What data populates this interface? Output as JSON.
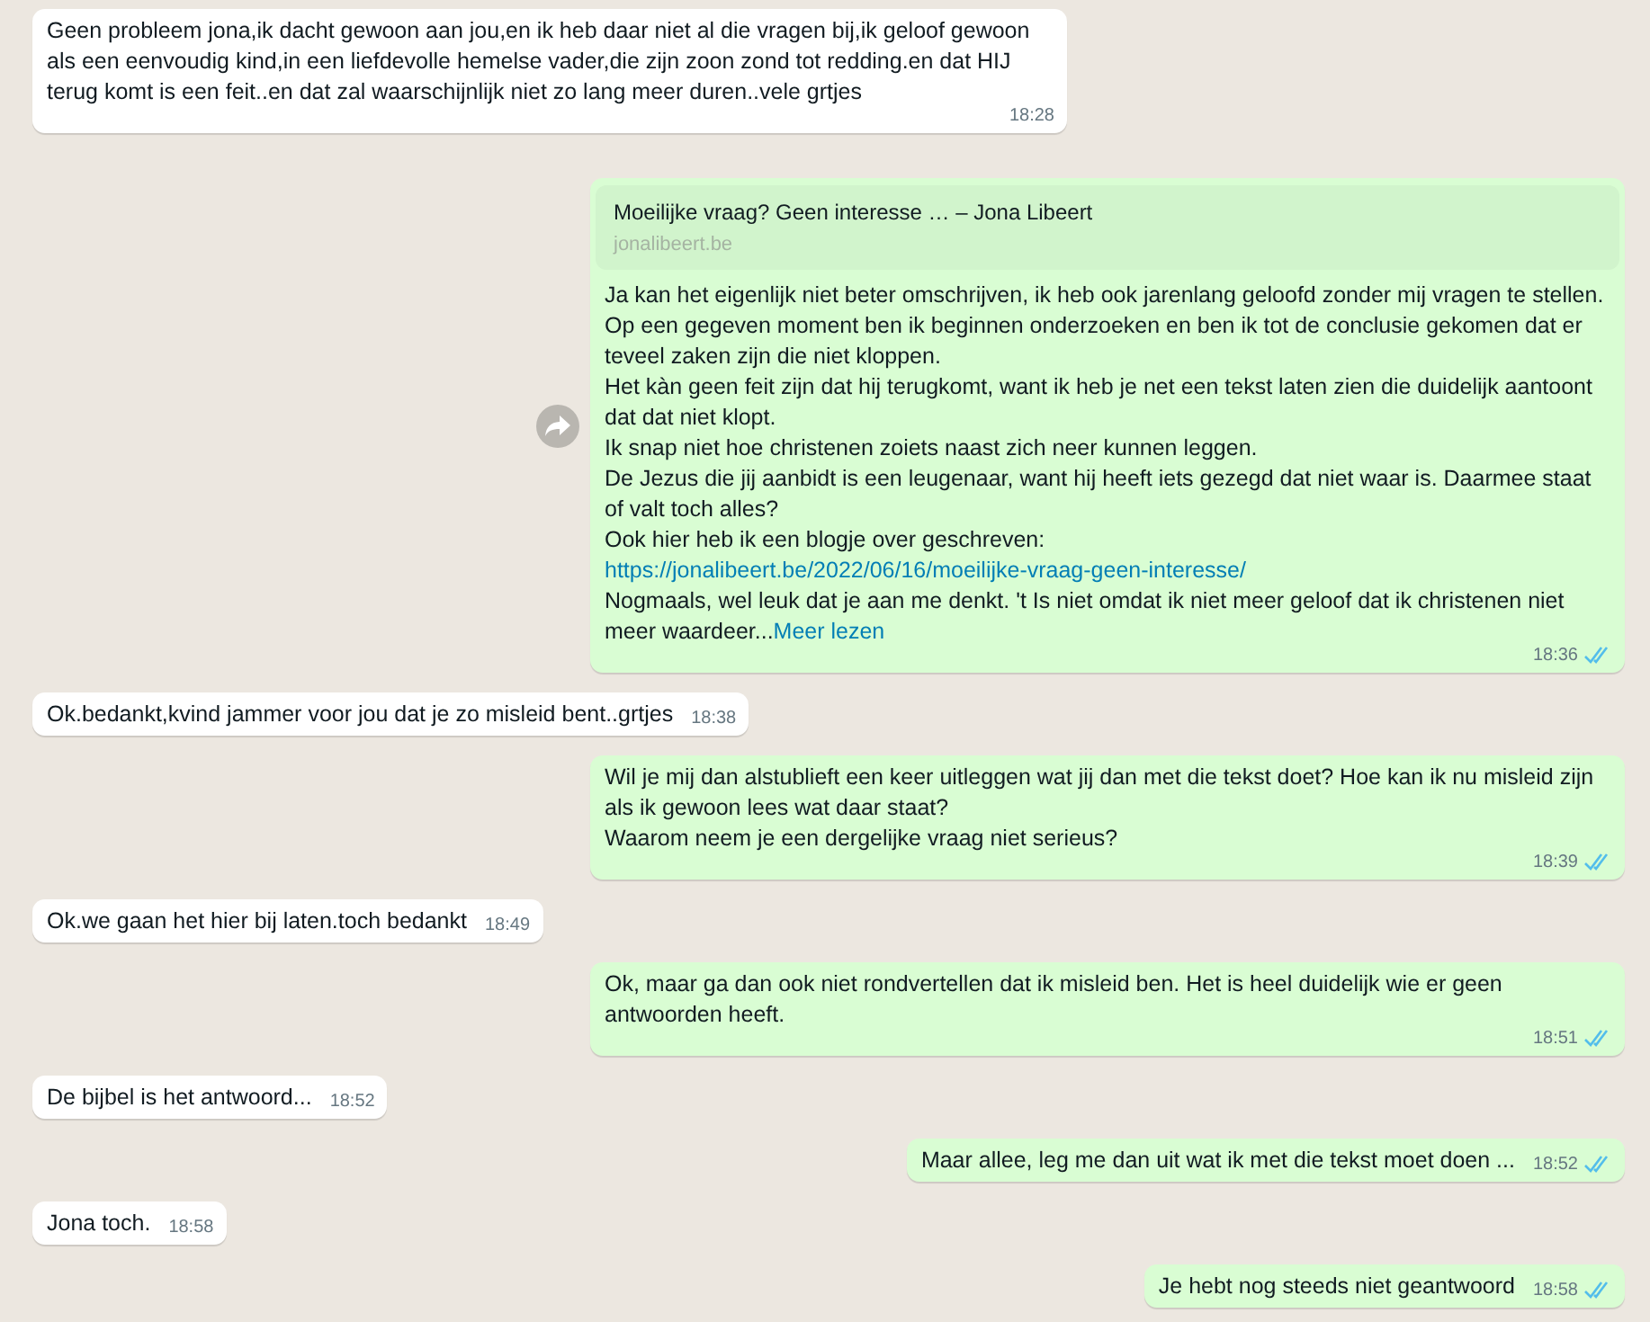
{
  "messages": [
    {
      "kind": "in",
      "parts": [
        {
          "kind": "text",
          "text": "Geen probleem jona,ik dacht gewoon aan jou,en ik heb daar niet al die vragen bij,ik geloof gewoon als een eenvoudig kind,in een liefdevolle hemelse vader,die zijn zoon zond tot redding.en dat HIJ terug komt is een feit..en dat zal waarschijnlijk niet zo lang meer duren..vele grtjes"
        }
      ],
      "time": "18:28"
    },
    {
      "kind": "out",
      "forward_button": true,
      "preview": {
        "title": "Moeilijke vraag? Geen interesse … – Jona Libeert",
        "domain": "jonalibeert.be"
      },
      "parts": [
        {
          "kind": "text",
          "text": "Ja kan het eigenlijk niet beter omschrijven, ik heb ook jarenlang geloofd zonder mij vragen te stellen. Op een gegeven moment ben ik beginnen onderzoeken en ben ik tot de conclusie gekomen dat er teveel zaken zijn die niet kloppen.\nHet kàn geen feit zijn dat hij terugkomt, want ik heb je net een tekst laten zien die duidelijk aantoont dat dat niet klopt.\nIk snap niet hoe christenen zoiets naast zich neer kunnen leggen.\nDe Jezus die jij aanbidt is een leugenaar, want hij heeft iets gezegd dat niet waar is. Daarmee staat of valt toch alles?\nOok hier heb ik een blogje over geschreven:\n"
        },
        {
          "kind": "link",
          "text": "https://jonalibeert.be/2022/06/16/moeilijke-vraag-geen-interesse/"
        },
        {
          "kind": "text",
          "text": "\nNogmaals, wel leuk dat je aan me denkt. 't Is niet omdat ik niet meer geloof dat ik christenen niet meer waardeer..."
        },
        {
          "kind": "more",
          "text": "Meer lezen"
        }
      ],
      "time": "18:36",
      "read": true
    },
    {
      "kind": "in",
      "parts": [
        {
          "kind": "text",
          "text": "Ok.bedankt,kvind jammer voor jou dat je zo misleid bent..grtjes"
        }
      ],
      "time": "18:38"
    },
    {
      "kind": "out",
      "parts": [
        {
          "kind": "text",
          "text": "Wil je mij dan alstublieft een keer uitleggen wat jij dan met die tekst doet? Hoe kan ik nu misleid zijn als ik gewoon lees wat daar staat?\nWaarom neem je een dergelijke vraag niet serieus?"
        }
      ],
      "time": "18:39",
      "read": true
    },
    {
      "kind": "in",
      "parts": [
        {
          "kind": "text",
          "text": "Ok.we gaan het hier bij laten.toch bedankt"
        }
      ],
      "time": "18:49"
    },
    {
      "kind": "out",
      "parts": [
        {
          "kind": "text",
          "text": "Ok, maar ga dan ook niet rondvertellen dat ik misleid ben. Het is heel duidelijk wie er geen antwoorden heeft."
        }
      ],
      "time": "18:51",
      "read": true
    },
    {
      "kind": "in",
      "parts": [
        {
          "kind": "text",
          "text": "De bijbel is het antwoord..."
        }
      ],
      "time": "18:52"
    },
    {
      "kind": "out",
      "parts": [
        {
          "kind": "text",
          "text": "Maar allee, leg me dan uit wat ik met die tekst moet doen ..."
        }
      ],
      "time": "18:52",
      "read": true
    },
    {
      "kind": "in",
      "parts": [
        {
          "kind": "text",
          "text": "Jona toch."
        }
      ],
      "time": "18:58"
    },
    {
      "kind": "out",
      "parts": [
        {
          "kind": "text",
          "text": "Je hebt nog steeds niet geantwoord"
        }
      ],
      "time": "18:58",
      "read": true
    }
  ]
}
